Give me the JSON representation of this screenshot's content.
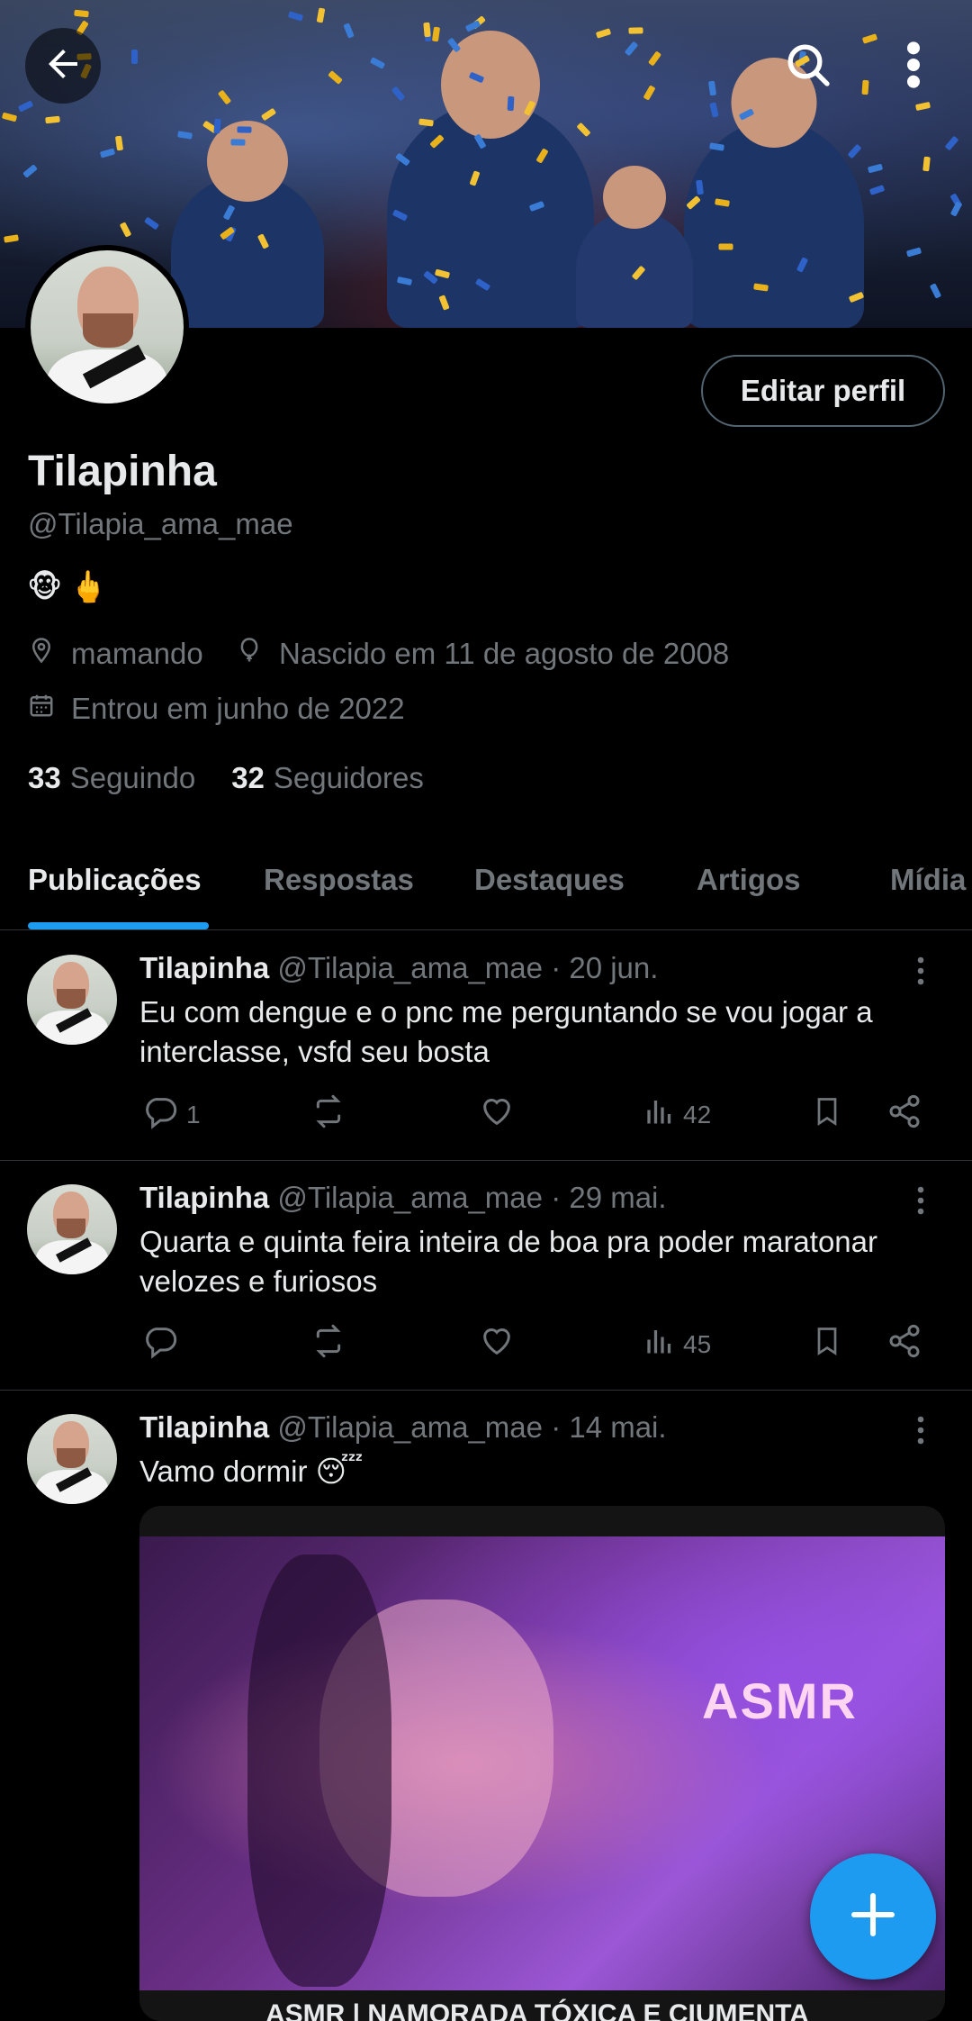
{
  "profile": {
    "name": "Tilapinha",
    "handle": "@Tilapia_ama_mae",
    "bio_emojis": [
      "🐵",
      "🖕"
    ],
    "location": "mamando",
    "birth": "Nascido em 11 de agosto de 2008",
    "joined": "Entrou em junho de 2022",
    "following_count": "33",
    "following_label": "Seguindo",
    "followers_count": "32",
    "followers_label": "Seguidores",
    "edit_label": "Editar perfil"
  },
  "tabs": [
    {
      "label": "Publicações",
      "active": true
    },
    {
      "label": "Respostas"
    },
    {
      "label": "Destaques"
    },
    {
      "label": "Artigos"
    },
    {
      "label": "Mídia"
    }
  ],
  "posts": [
    {
      "name": "Tilapinha",
      "handle": "@Tilapia_ama_mae",
      "date": "· 20 jun.",
      "text": "Eu com dengue e o pnc me perguntando se vou jogar a interclasse, vsfd seu bosta",
      "replies": "1",
      "views": "42"
    },
    {
      "name": "Tilapinha",
      "handle": "@Tilapia_ama_mae",
      "date": "· 29 mai.",
      "text": "Quarta e quinta feira inteira de boa pra poder maratonar velozes e furiosos",
      "replies": "",
      "views": "45"
    },
    {
      "name": "Tilapinha",
      "handle": "@Tilapia_ama_mae",
      "date": "· 14 mai.",
      "text": "Vamo dormir 😴",
      "media_overlay_text": "ASMR",
      "media_caption": "ASMR | NAMORADA TÓXICA E CIUMENTA"
    }
  ],
  "colors": {
    "accent": "#1d9bf0",
    "text_primary": "#e7e9ea",
    "text_secondary": "#71767b",
    "border": "#2f3336",
    "background": "#000000"
  },
  "icons": {
    "back": "arrow-left-icon",
    "search": "search-icon",
    "more": "more-vertical-icon",
    "location": "location-pin-icon",
    "birthday": "balloon-icon",
    "calendar": "calendar-icon",
    "reply": "reply-icon",
    "repost": "repost-icon",
    "like": "heart-icon",
    "views": "views-icon",
    "bookmark": "bookmark-icon",
    "share": "share-icon",
    "compose": "plus-icon"
  }
}
